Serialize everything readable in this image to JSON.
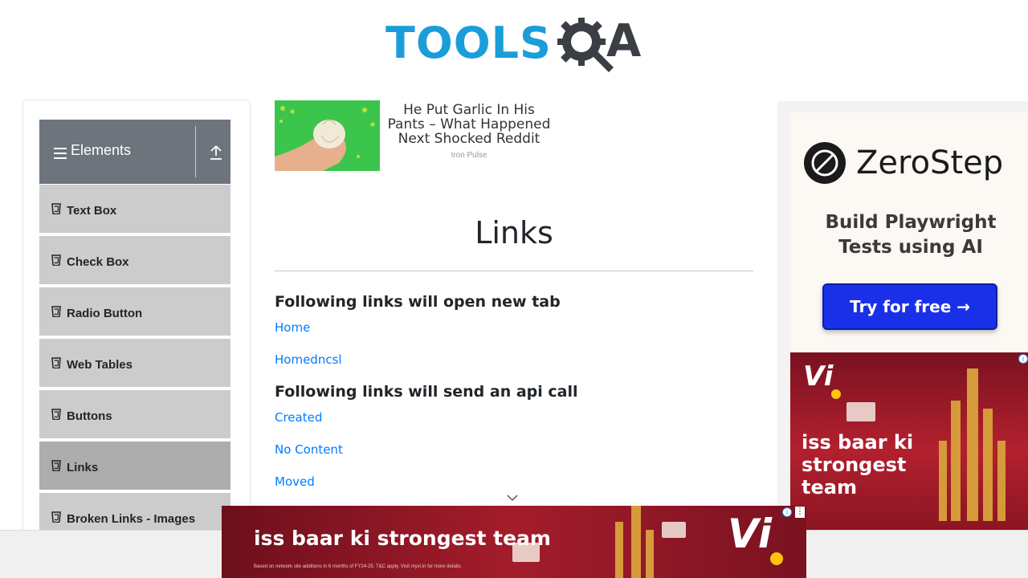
{
  "brand": {
    "logo_left": "TOOLS",
    "logo_right": "A"
  },
  "sidebar": {
    "group_title": "Elements",
    "items": [
      {
        "label": "Text Box",
        "active": false
      },
      {
        "label": "Check Box",
        "active": false
      },
      {
        "label": "Radio Button",
        "active": false
      },
      {
        "label": "Web Tables",
        "active": false
      },
      {
        "label": "Buttons",
        "active": false
      },
      {
        "label": "Links",
        "active": true
      },
      {
        "label": "Broken Links - Images",
        "active": false
      }
    ]
  },
  "top_ad": {
    "headline": "He Put Garlic In His Pants – What Happened Next Shocked Reddit",
    "source": "Iron Pulse"
  },
  "main": {
    "title": "Links",
    "section_new_tab": "Following links will open new tab",
    "new_tab_links": [
      "Home",
      "Homedncsl"
    ],
    "section_api": "Following links will send an api call",
    "api_links": [
      "Created",
      "No Content",
      "Moved"
    ]
  },
  "right_ad": {
    "brand": "ZeroStep",
    "tagline": "Build Playwright Tests using AI",
    "cta": "Try for free →"
  },
  "vi_ad": {
    "logo": "Vi",
    "tagline": "iss baar ki strongest team"
  },
  "bottom_ad": {
    "text": "iss baar ki strongest team",
    "logo": "Vi",
    "fineprint": "Based on network site additions in 6 months of FY24-25. T&C apply. Visit myvi.in for more details."
  },
  "colors": {
    "accent_link": "#007bff",
    "sidebar_header": "#6d747c",
    "menu_item": "#cccccc",
    "menu_item_active": "#adadad",
    "logo_blue": "#1a9dd9",
    "cta_blue": "#1a30e8"
  },
  "icons": {
    "group": "hamburger-icon",
    "collapse": "upload-icon",
    "menu_item": "file-icon",
    "scroll": "chevron-down-icon"
  }
}
